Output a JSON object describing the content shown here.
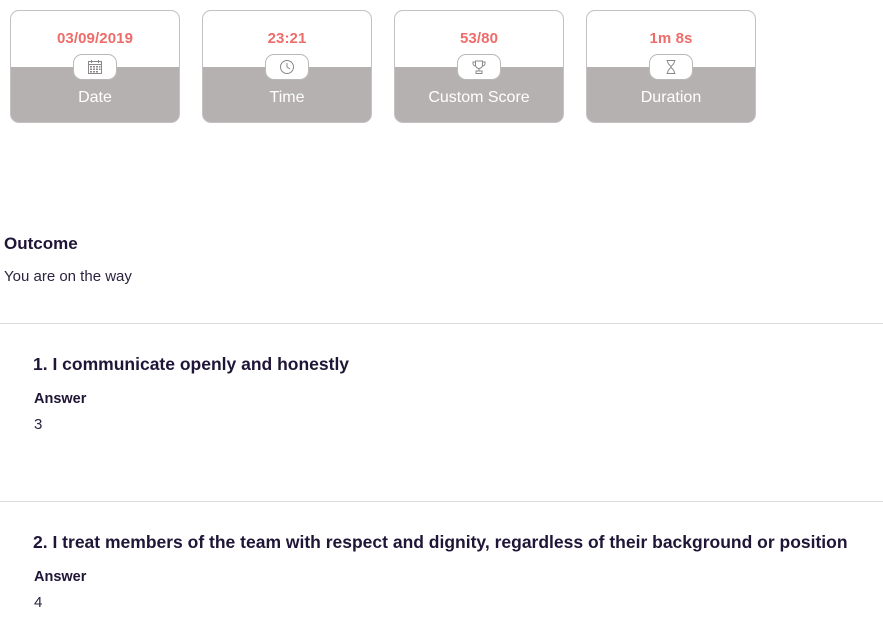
{
  "stats": [
    {
      "value": "03/09/2019",
      "label": "Date",
      "icon": "calendar-icon"
    },
    {
      "value": "23:21",
      "label": "Time",
      "icon": "clock-icon"
    },
    {
      "value": "53/80",
      "label": "Custom Score",
      "icon": "trophy-icon"
    },
    {
      "value": "1m 8s",
      "label": "Duration",
      "icon": "hourglass-icon"
    }
  ],
  "outcome": {
    "title": "Outcome",
    "text": "You are on the way"
  },
  "questions": [
    {
      "title": "1. I communicate openly and honestly",
      "answer_label": "Answer",
      "answer": "3"
    },
    {
      "title": "2. I treat members of the team with respect and dignity, regardless of their background or position",
      "answer_label": "Answer",
      "answer": "4"
    }
  ],
  "colors": {
    "accent": "#ee6c69",
    "card_bottom": "#b5b1b1",
    "text": "#1f1536"
  }
}
